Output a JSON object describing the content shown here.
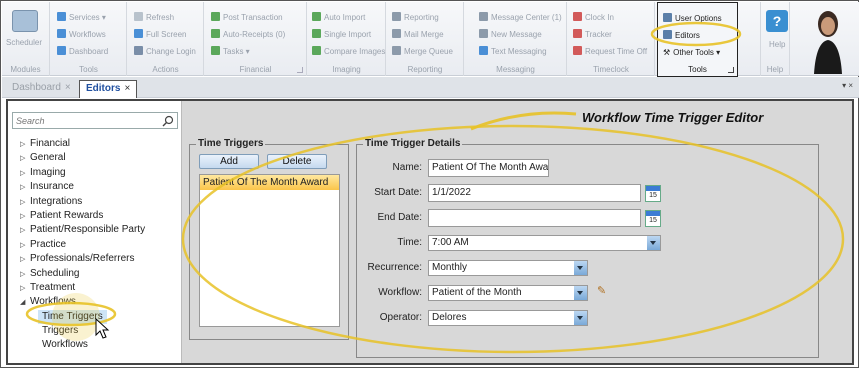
{
  "ribbon": {
    "scheduler": {
      "label": "Scheduler",
      "group": "Modules"
    },
    "tools": {
      "items": [
        "Services",
        "Workflows",
        "Dashboard"
      ],
      "group": "Tools"
    },
    "actions": {
      "items": [
        "Refresh",
        "Full Screen",
        "Change Login"
      ],
      "group": "Actions"
    },
    "financial": {
      "items": [
        "Post Transaction",
        "Auto-Receipts (0)",
        "Tasks"
      ],
      "group": "Financial"
    },
    "imaging": {
      "items": [
        "Auto Import",
        "Single Import",
        "Compare Images"
      ],
      "group": "Imaging"
    },
    "reporting": {
      "items": [
        "Reporting",
        "Mail Merge",
        "Merge Queue"
      ],
      "group": "Reporting"
    },
    "messaging": {
      "items": [
        "Message Center (1)",
        "New Message",
        "Text Messaging"
      ],
      "group": "Messaging"
    },
    "timeclock": {
      "items": [
        "Clock In",
        "Tracker",
        "Request Time Off"
      ],
      "group": "Timeclock"
    },
    "toolsmenu": {
      "items": [
        "User Options",
        "Editors",
        "Other Tools"
      ],
      "group": "Tools"
    },
    "help": {
      "label": "Help",
      "group": "Help"
    }
  },
  "tabs": [
    {
      "label": "Dashboard"
    },
    {
      "label": "Editors"
    }
  ],
  "search": {
    "placeholder": "Search"
  },
  "tree": {
    "items": [
      "Financial",
      "General",
      "Imaging",
      "Insurance",
      "Integrations",
      "Patient Rewards",
      "Patient/Responsible Party",
      "Practice",
      "Professionals/Referrers",
      "Scheduling",
      "Treatment",
      "Workflows"
    ],
    "children": [
      "Time Triggers",
      "Triggers",
      "Workflows"
    ]
  },
  "editor": {
    "title": "Workflow Time Trigger Editor",
    "triggers_legend": "Time Triggers",
    "add_label": "Add",
    "delete_label": "Delete",
    "list": [
      "Patient Of The Month Award"
    ],
    "details_legend": "Time Trigger Details",
    "fields": {
      "name_label": "Name:",
      "name_value": "Patient Of The Month Awa",
      "start_label": "Start Date:",
      "start_value": "1/1/2022",
      "end_label": "End Date:",
      "end_value": "",
      "time_label": "Time:",
      "time_value": "7:00 AM",
      "recurrence_label": "Recurrence:",
      "recurrence_value": "Monthly",
      "workflow_label": "Workflow:",
      "workflow_value": "Patient of the Month",
      "operator_label": "Operator:",
      "operator_value": "Delores"
    },
    "calendar_day": "15"
  },
  "colors": {
    "highlight": "#e8c227",
    "accent": "#2050a0"
  }
}
